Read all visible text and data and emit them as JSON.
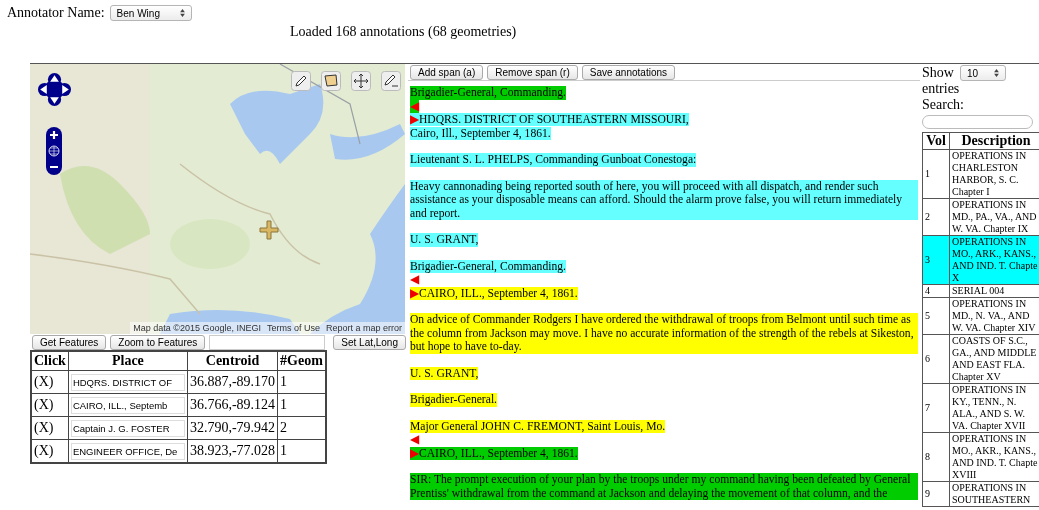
{
  "annotator": {
    "label": "Annotator Name:",
    "value": "Ben Wing"
  },
  "status": "Loaded 168 annotations (68 geometries)",
  "map": {
    "attribution": [
      "Map data ©2015 Google, INEGI",
      "Terms of Use",
      "Report a map error"
    ]
  },
  "map_controls": [
    {
      "kind": "button",
      "label": "Get Features"
    },
    {
      "kind": "button",
      "label": "Zoom to Features"
    },
    {
      "kind": "field"
    },
    {
      "kind": "button",
      "label": "Set Lat,Long"
    }
  ],
  "places": {
    "columns": [
      "Click",
      "Place",
      "Centroid",
      "#Geom"
    ],
    "rows": [
      {
        "click": "(X)",
        "place": "HDQRS. DISTRICT OF",
        "centroid": "36.887,-89.170",
        "geoms": "1"
      },
      {
        "click": "(X)",
        "place": "CAIRO, ILL., Septemb",
        "centroid": "36.766,-89.124",
        "geoms": "1"
      },
      {
        "click": "(X)",
        "place": "Captain J. G. FOSTER",
        "centroid": "32.790,-79.942",
        "geoms": "2"
      },
      {
        "click": "(X)",
        "place": "ENGINEER OFFICE, De",
        "centroid": "38.923,-77.028",
        "geoms": "1"
      }
    ]
  },
  "editor": {
    "buttons": [
      "Add span (a)",
      "Remove span (r)",
      "Save annotations"
    ],
    "paragraphs": [
      {
        "lines": [
          [
            {
              "kind": "text",
              "text": "Brigadier-General, Commanding.",
              "color": "#00cc00"
            }
          ],
          [
            {
              "kind": "end",
              "text": "◀",
              "color": "#00cc00"
            }
          ],
          [
            {
              "kind": "start",
              "text": "▶",
              "color": "#66ffff"
            },
            {
              "kind": "text",
              "text": "HDQRS. DISTRICT OF SOUTHEASTERN MISSOURI,",
              "color": "#66ffff"
            }
          ],
          [
            {
              "kind": "text",
              "text": "Cairo, Ill., September 4, 1861.",
              "color": "#66ffff"
            }
          ]
        ]
      },
      {
        "lines": [
          [
            {
              "kind": "text",
              "text": "Lieutenant S. L. PHELPS, Commanding Gunboat Conestoga:",
              "color": "#66ffff"
            }
          ]
        ]
      },
      {
        "lines": [
          [
            {
              "kind": "text",
              "text": "Heavy cannonading being reported south of here, you will proceed with all dispatch, and render such assistance as your disposable means can afford. Should the alarm prove false, you will return immediately and report.",
              "color": "#66ffff"
            }
          ]
        ]
      },
      {
        "lines": [
          [
            {
              "kind": "text",
              "text": "U. S. GRANT,",
              "color": "#66ffff"
            }
          ]
        ]
      },
      {
        "lines": [
          [
            {
              "kind": "text",
              "text": "Brigadier-General, Commanding.",
              "color": "#66ffff"
            }
          ],
          [
            {
              "kind": "end",
              "text": "◀"
            }
          ],
          [
            {
              "kind": "start",
              "text": "▶",
              "color": "#ffff00"
            },
            {
              "kind": "text",
              "text": "CAIRO, ILL., September 4, 1861.",
              "color": "#ffff00"
            }
          ]
        ]
      },
      {
        "lines": [
          [
            {
              "kind": "text",
              "text": "On advice of Commander Rodgers I have ordered the withdrawal of troops from Belmont until such time as the column from Jackson may move. I have no accurate information of the strength of the rebels at Sikeston, but hope to have to-day.",
              "color": "#ffff00"
            }
          ]
        ]
      },
      {
        "lines": [
          [
            {
              "kind": "text",
              "text": "U. S. GRANT,",
              "color": "#ffff00"
            }
          ]
        ]
      },
      {
        "lines": [
          [
            {
              "kind": "text",
              "text": "Brigadier-General.",
              "color": "#ffff00"
            }
          ]
        ]
      },
      {
        "lines": [
          [
            {
              "kind": "text",
              "text": "Major General JOHN C. FREMONT, Saint Louis, Mo.",
              "color": "#ffff00"
            }
          ],
          [
            {
              "kind": "end",
              "text": "◀"
            }
          ],
          [
            {
              "kind": "start",
              "text": "▶",
              "color": "#00cc00"
            },
            {
              "kind": "text",
              "text": "CAIRO, ILL., September 4, 1861.",
              "color": "#00cc00"
            }
          ]
        ]
      },
      {
        "lines": [
          [
            {
              "kind": "text",
              "text": "SIR: The prompt execution of your plan by the troops under my command having been defeated by General Prentiss' withdrawal from the command at Jackson and delaying the movement of that column, and the",
              "color": "#00cc00"
            }
          ]
        ]
      }
    ]
  },
  "volumes": {
    "show_label": "Show",
    "page_size": "10",
    "entries_label": "entries",
    "search_label": "Search:",
    "columns": [
      "Vol",
      "Description"
    ],
    "rows": [
      {
        "vol": "1",
        "description": "OPERATIONS IN CHARLESTON HARBOR, S. C. Chapter I",
        "selected": false
      },
      {
        "vol": "2",
        "description": "OPERATIONS IN MD., PA., VA., AND W. VA. Chapter IX",
        "selected": false
      },
      {
        "vol": "3",
        "description": "OPERATIONS IN MO., ARK., KANS., AND IND. T. Chapte X",
        "selected": true
      },
      {
        "vol": "4",
        "description": "SERIAL 004",
        "selected": false
      },
      {
        "vol": "5",
        "description": "OPERATIONS IN MD., N. VA., AND W. VA. Chapter XIV",
        "selected": false
      },
      {
        "vol": "6",
        "description": "COASTS OF S.C., GA., AND MIDDLE AND EAST FLA. Chapter XV",
        "selected": false
      },
      {
        "vol": "7",
        "description": "OPERATIONS IN KY., TENN., N. ALA., AND S. W. VA. Chapter XVII",
        "selected": false
      },
      {
        "vol": "8",
        "description": "OPERATIONS IN MO., AKR., KANS., AND IND. T. Chapte XVIII",
        "selected": false
      },
      {
        "vol": "9",
        "description": "OPERATIONS IN SOUTHEASTERN",
        "selected": false
      }
    ]
  }
}
